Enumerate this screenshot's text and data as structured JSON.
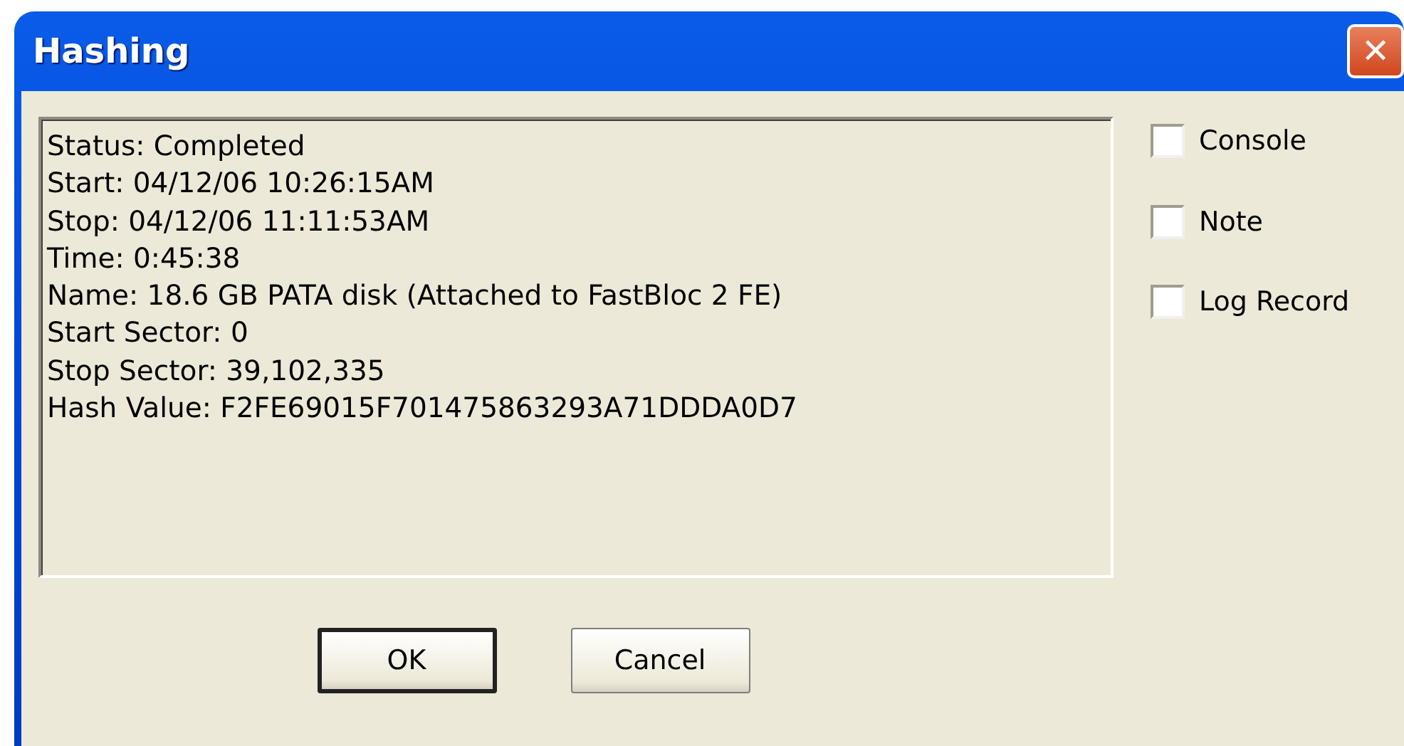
{
  "window": {
    "title": "Hashing",
    "close_glyph": "✕"
  },
  "log_lines": [
    "Status: Completed",
    "Start: 04/12/06 10:26:15AM",
    "Stop: 04/12/06 11:11:53AM",
    "Time: 0:45:38",
    "Name: 18.6 GB PATA disk (Attached to FastBloc 2 FE)",
    "Start Sector: 0",
    "Stop Sector: 39,102,335",
    "Hash Value: F2FE69015F701475863293A71DDDA0D7"
  ],
  "options": [
    {
      "label": "Console",
      "checked": false
    },
    {
      "label": "Note",
      "checked": false
    },
    {
      "label": "Log Record",
      "checked": false
    }
  ],
  "buttons": [
    {
      "label": "OK",
      "default": true
    },
    {
      "label": "Cancel",
      "default": false
    }
  ]
}
